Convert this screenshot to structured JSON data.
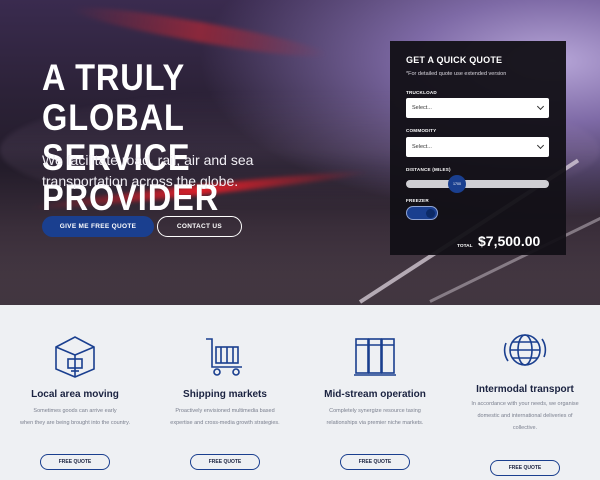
{
  "hero": {
    "title_line1": "A TRULY GLOBAL",
    "title_line2": "SERVICE PROVIDER",
    "subtitle_line1": "We facilitate road, rail, air and sea",
    "subtitle_line2": "transportation across the globe.",
    "primary_button": "GIVE ME FREE QUOTE",
    "secondary_button": "CONTACT US"
  },
  "quote_panel": {
    "title": "GET A QUICK QUOTE",
    "note": "*For detailed quote use extended version",
    "truckload_label": "TRUCKLOAD",
    "truckload_value": "Select...",
    "commodity_label": "COMMODITY",
    "commodity_value": "Select...",
    "distance_label": "DISTANCE (MILES)",
    "distance_value": "1700",
    "freezer_label": "FREEZER",
    "freezer_on": true,
    "total_label": "TOTAL",
    "total_value": "$7,500.00"
  },
  "features": [
    {
      "icon": "box-icon",
      "title": "Local area moving",
      "desc_line1": "Sometimes goods can arrive early",
      "desc_line2": "when they are being brought into the country.",
      "desc_line3": "",
      "button": "FREE QUOTE"
    },
    {
      "icon": "cart-icon",
      "title": "Shipping markets",
      "desc_line1": "Proactively envisioned multimedia based",
      "desc_line2": "expertise and cross-media growth strategies.",
      "desc_line3": "",
      "button": "FREE QUOTE"
    },
    {
      "icon": "containers-icon",
      "title": "Mid-stream operation",
      "desc_line1": "Completely synergize resource taxing",
      "desc_line2": "relationships via premier niche markets.",
      "desc_line3": "",
      "button": "FREE QUOTE"
    },
    {
      "icon": "globe-icon",
      "title": "Intermodal transport",
      "desc_line1": "In accordance with your needs, we organise",
      "desc_line2": "domestic and international deliveries of",
      "desc_line3": "collective.",
      "button": "FREE QUOTE"
    }
  ]
}
